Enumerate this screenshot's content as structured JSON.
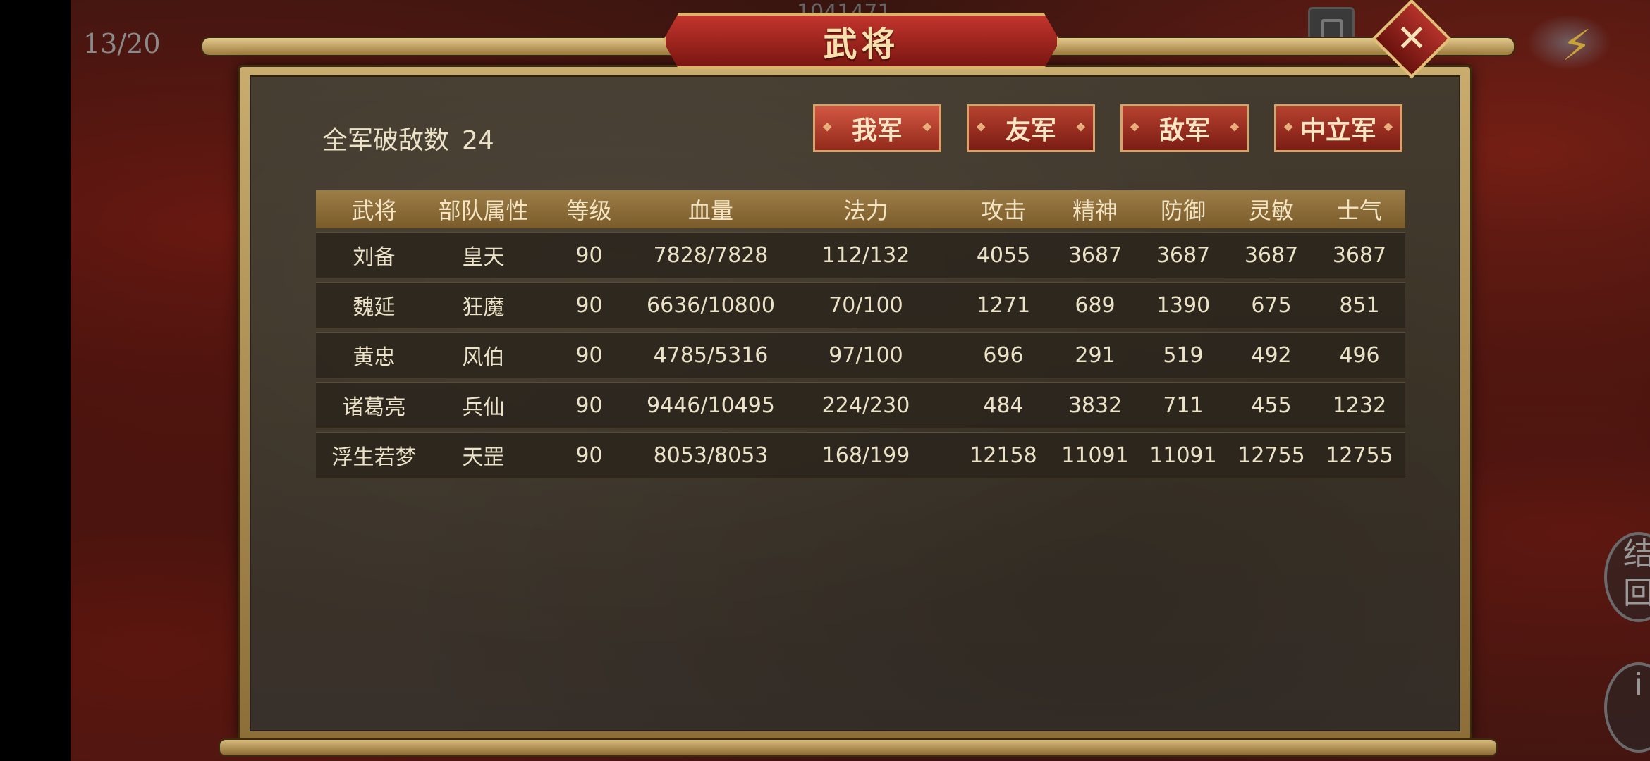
{
  "hud": {
    "turn": "13/20",
    "top_score": "1041471",
    "side_btn_1": "结\n回",
    "side_btn_2": "i"
  },
  "dialog": {
    "title": "武将",
    "kill_label": "全军破敌数",
    "kill_value": "24",
    "factions": [
      {
        "label": "我军",
        "active": true
      },
      {
        "label": "友军",
        "active": false
      },
      {
        "label": "敌军",
        "active": false
      },
      {
        "label": "中立军",
        "active": false
      }
    ],
    "columns": [
      "武将",
      "部队属性",
      "等级",
      "血量",
      "法力",
      "攻击",
      "精神",
      "防御",
      "灵敏",
      "士气"
    ],
    "rows": [
      [
        "刘备",
        "皇天",
        "90",
        "7828/7828",
        "112/132",
        "4055",
        "3687",
        "3687",
        "3687",
        "3687"
      ],
      [
        "魏延",
        "狂魔",
        "90",
        "6636/10800",
        "70/100",
        "1271",
        "689",
        "1390",
        "675",
        "851"
      ],
      [
        "黄忠",
        "风伯",
        "90",
        "4785/5316",
        "97/100",
        "696",
        "291",
        "519",
        "492",
        "496"
      ],
      [
        "诸葛亮",
        "兵仙",
        "90",
        "9446/10495",
        "224/230",
        "484",
        "3832",
        "711",
        "455",
        "1232"
      ],
      [
        "浮生若梦",
        "天罡",
        "90",
        "8053/8053",
        "168/199",
        "12158",
        "11091",
        "11091",
        "12755",
        "12755"
      ]
    ]
  },
  "colors": {
    "accent_red": "#b6412f",
    "gold": "#d9b56a",
    "text": "#ece2c8"
  },
  "icons": {
    "close": "close-icon",
    "weather": "lightning-cloud-icon"
  }
}
